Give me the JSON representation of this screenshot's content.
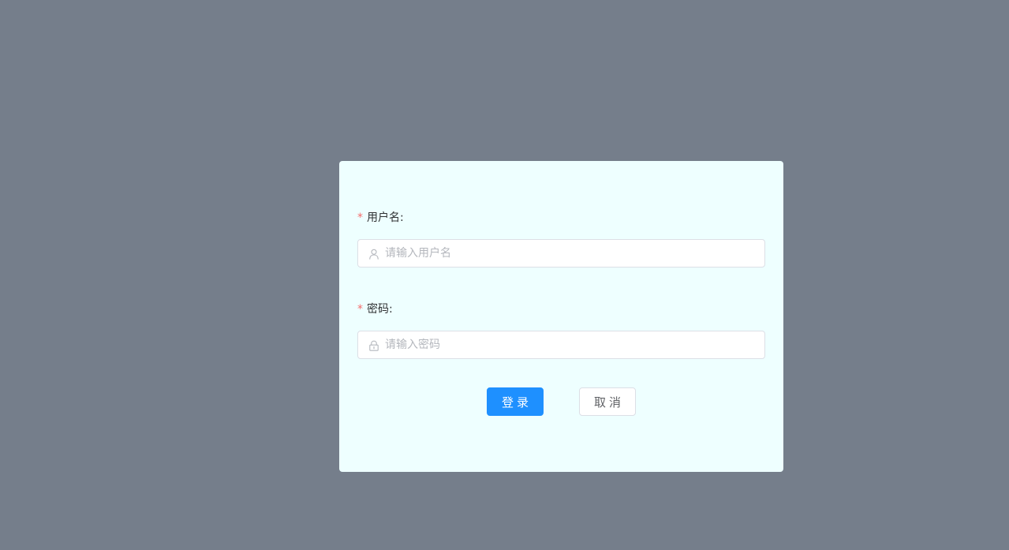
{
  "colors": {
    "background": "#757e8b",
    "card": "#eeffff",
    "primary": "#1e90ff",
    "required": "#f56c6c"
  },
  "form": {
    "username": {
      "required_mark": "*",
      "label": "用户名:",
      "placeholder": "请输入用户名",
      "value": "",
      "icon": "user-icon"
    },
    "password": {
      "required_mark": "*",
      "label": "密码:",
      "placeholder": "请输入密码",
      "value": "",
      "icon": "lock-icon"
    }
  },
  "buttons": {
    "login": "登录",
    "cancel": "取消"
  }
}
